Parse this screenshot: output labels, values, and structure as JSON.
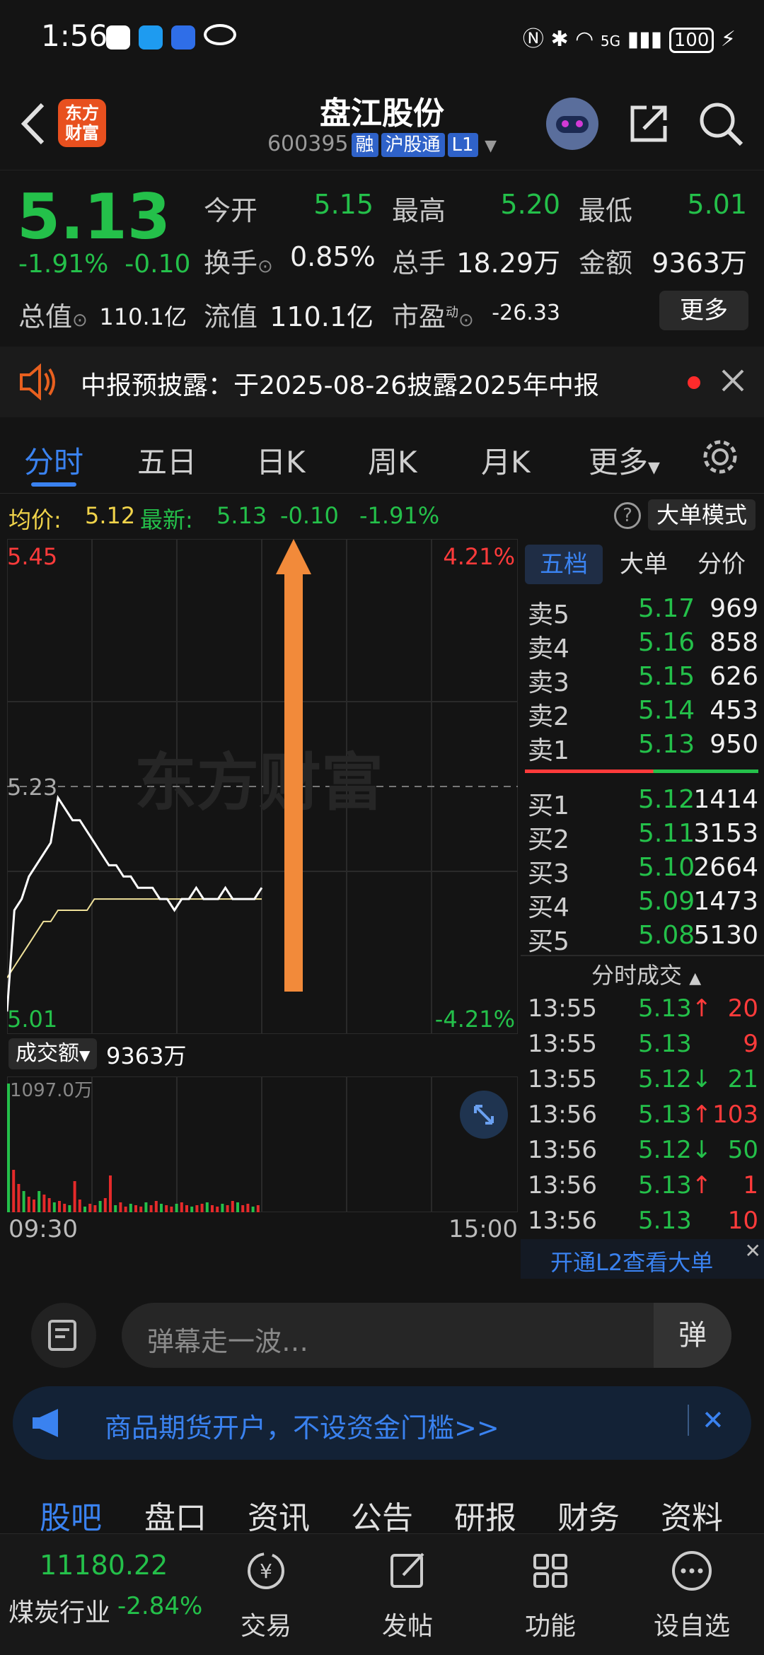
{
  "status": {
    "time": "1:56",
    "network": "5G",
    "battery": "100"
  },
  "header": {
    "name": "盘江股份",
    "code": "600395",
    "tags": [
      "融",
      "沪股通",
      "L1"
    ],
    "logo_text": "东方\n财富"
  },
  "quote": {
    "price": "5.13",
    "change_pct": "-1.91%",
    "change": "-0.10",
    "labels": {
      "open": "今开",
      "high": "最高",
      "low": "最低",
      "turnover": "换手",
      "volume": "总手",
      "amount": "金额",
      "total_mv": "总值",
      "float_mv": "流值",
      "pe": "市盈"
    },
    "values": {
      "open": "5.15",
      "high": "5.20",
      "low": "5.01",
      "turnover": "0.85%",
      "volume": "18.29万",
      "amount": "9363万",
      "total_mv": "110.1亿",
      "float_mv": "110.1亿",
      "pe": "-26.33"
    },
    "pe_superscript": "动",
    "more_label": "更多"
  },
  "notice": {
    "text": "中报预披露：于2025-08-26披露2025年中报"
  },
  "tabs": [
    "分时",
    "五日",
    "日K",
    "周K",
    "月K",
    "更多"
  ],
  "chartbar": {
    "avg_label": "均价:",
    "avg": "5.12",
    "latest_label": "最新:",
    "latest": "5.13",
    "chg": "-0.10",
    "pct": "-1.91%",
    "mode_label": "大单模式"
  },
  "chart": {
    "top_price": "5.45",
    "mid_price": "5.23",
    "low_price": "5.01",
    "top_pct": "4.21%",
    "low_pct": "-4.21%",
    "watermark": "东方财富",
    "start_time": "09:30",
    "end_time": "15:00"
  },
  "volume": {
    "label": "成交额",
    "total": "9363万",
    "max_label": "1097.0万"
  },
  "chart_data": {
    "type": "line",
    "title": "",
    "ylim": [
      5.01,
      5.45
    ],
    "series": [
      {
        "values": [
          5.03,
          5.12,
          5.13,
          5.15,
          5.16,
          5.17,
          5.18,
          5.22,
          5.21,
          5.2,
          5.2,
          5.19,
          5.18,
          5.17,
          5.16,
          5.16,
          5.15,
          5.15,
          5.14,
          5.14,
          5.14,
          5.13,
          5.13,
          5.12,
          5.13,
          5.13,
          5.14,
          5.13,
          5.13,
          5.13,
          5.14,
          5.13,
          5.13,
          5.13,
          5.13,
          5.14
        ]
      },
      {
        "values": [
          5.06,
          5.07,
          5.08,
          5.09,
          5.1,
          5.11,
          5.11,
          5.12,
          5.12,
          5.12,
          5.12,
          5.12,
          5.13,
          5.13,
          5.13,
          5.13,
          5.13,
          5.13,
          5.13,
          5.13,
          5.13,
          5.13,
          5.13,
          5.13,
          5.13,
          5.13,
          5.13,
          5.13,
          5.13,
          5.13,
          5.13,
          5.13,
          5.13,
          5.13,
          5.13,
          5.13
        ]
      }
    ]
  },
  "book": {
    "tabs": [
      "五档",
      "大单",
      "分价"
    ],
    "asks": [
      {
        "label": "卖5",
        "price": "5.17",
        "vol": "969"
      },
      {
        "label": "卖4",
        "price": "5.16",
        "vol": "858"
      },
      {
        "label": "卖3",
        "price": "5.15",
        "vol": "626"
      },
      {
        "label": "卖2",
        "price": "5.14",
        "vol": "453"
      },
      {
        "label": "卖1",
        "price": "5.13",
        "vol": "950"
      }
    ],
    "bids": [
      {
        "label": "买1",
        "price": "5.12",
        "vol": "1414"
      },
      {
        "label": "买2",
        "price": "5.11",
        "vol": "3153"
      },
      {
        "label": "买3",
        "price": "5.10",
        "vol": "2664"
      },
      {
        "label": "买4",
        "price": "5.09",
        "vol": "1473"
      },
      {
        "label": "买5",
        "price": "5.08",
        "vol": "5130"
      }
    ],
    "trades_title": "分时成交",
    "trades": [
      {
        "time": "13:55",
        "price": "5.13",
        "arrow": "↑",
        "vol": "20"
      },
      {
        "time": "13:55",
        "price": "5.13",
        "arrow": "",
        "vol": "9"
      },
      {
        "time": "13:55",
        "price": "5.12",
        "arrow": "↓",
        "vol": "21"
      },
      {
        "time": "13:56",
        "price": "5.13",
        "arrow": "↑",
        "vol": "103"
      },
      {
        "time": "13:56",
        "price": "5.12",
        "arrow": "↓",
        "vol": "50"
      },
      {
        "time": "13:56",
        "price": "5.13",
        "arrow": "↑",
        "vol": "1"
      },
      {
        "time": "13:56",
        "price": "5.13",
        "arrow": "",
        "vol": "10"
      }
    ],
    "l2_label": "开通L2查看大单"
  },
  "danmu": {
    "placeholder": "弹幕走一波…",
    "send": "弹"
  },
  "ad": {
    "text": "商品期货开户，不设资金门槛>>"
  },
  "sectabs": [
    "股吧",
    "盘口",
    "资讯",
    "公告",
    "研报",
    "财务",
    "资料"
  ],
  "botnav": {
    "index_value": "11180.22",
    "index_name": "煤炭行业",
    "index_pct": "-2.84%",
    "items": [
      "交易",
      "发帖",
      "功能",
      "设自选"
    ]
  }
}
